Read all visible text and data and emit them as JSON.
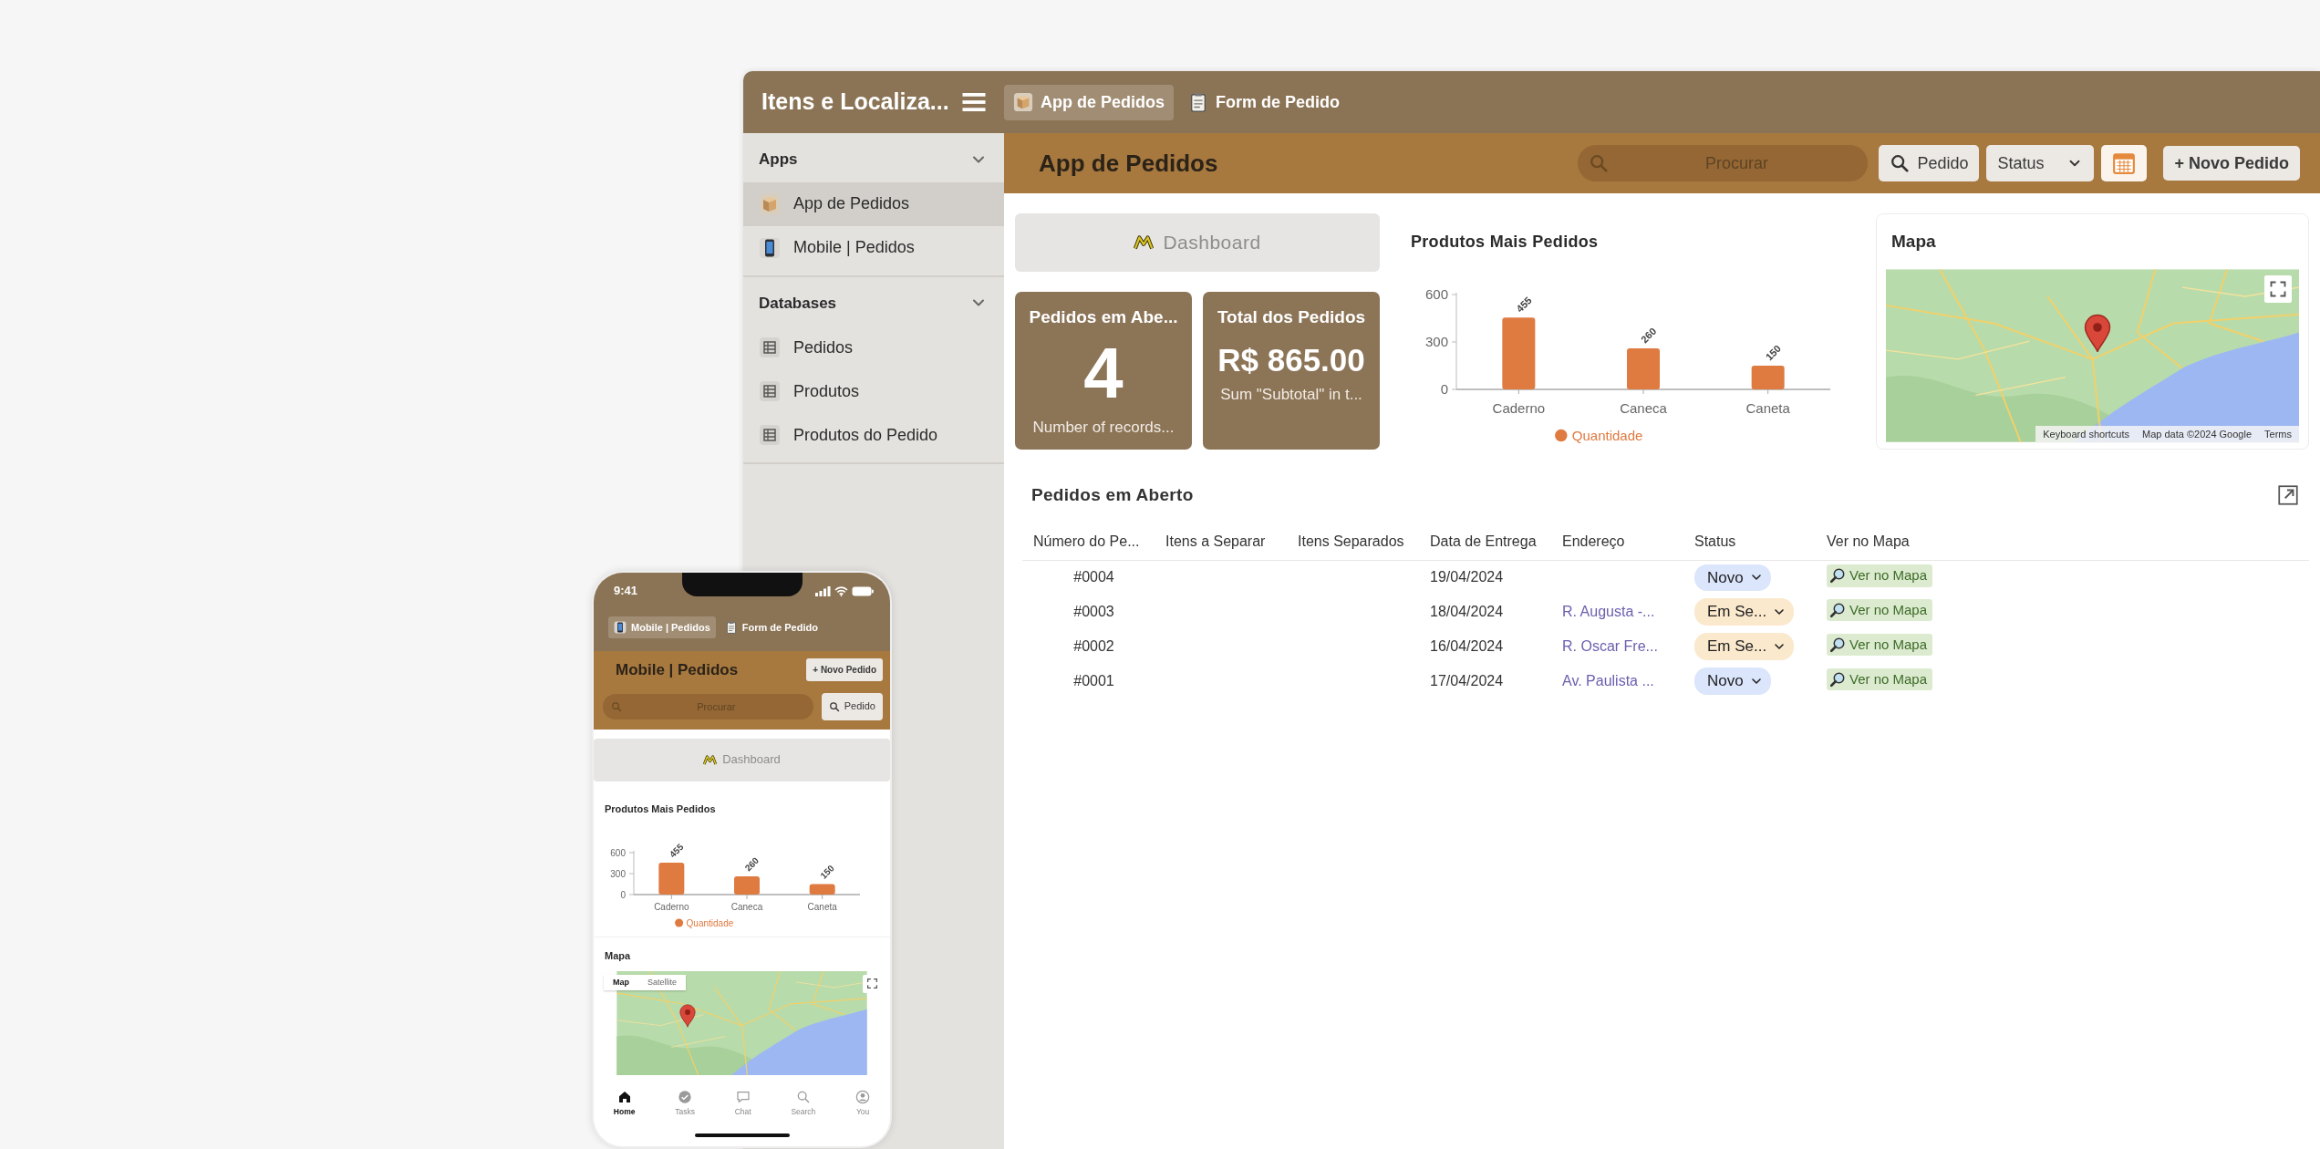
{
  "desktop": {
    "app_title": "Itens e Localiza...",
    "tabs": [
      {
        "label": "App de Pedidos",
        "kind": "app",
        "selected": true
      },
      {
        "label": "Form de Pedido",
        "kind": "form",
        "selected": false
      }
    ],
    "sidebar": [
      {
        "title": "Apps",
        "expanded": true,
        "items": [
          {
            "label": "App de Pedidos",
            "kind": "desktop",
            "selected": true
          },
          {
            "label": "Mobile | Pedidos",
            "kind": "mobile",
            "selected": false
          }
        ]
      },
      {
        "title": "Databases",
        "expanded": true,
        "items": [
          {
            "label": "Pedidos",
            "kind": "table",
            "selected": false
          },
          {
            "label": "Produtos",
            "kind": "table",
            "selected": false
          },
          {
            "label": "Produtos do Pedido",
            "kind": "table",
            "selected": false
          }
        ]
      }
    ],
    "page_title": "App de Pedidos",
    "search": {
      "placeholder": "Procurar"
    },
    "pedido_button": "Pedido",
    "status_filter": "Status",
    "new_button": "+ Novo Pedido",
    "dashboard_label": "Dashboard",
    "stats": [
      {
        "kind": "count",
        "title": "Pedidos em Abe...",
        "value": "4",
        "caption": "Number of records..."
      },
      {
        "kind": "sum",
        "title": "Total dos Pedidos",
        "value": "R$ 865.00",
        "caption": "Sum \"Subtotal\" in t..."
      }
    ],
    "chart": {
      "title": "Produtos Mais Pedidos",
      "chart_data": {
        "type": "bar",
        "categories": [
          "Caderno",
          "Caneca",
          "Caneta"
        ],
        "series": [
          {
            "name": "Quantidade",
            "color": "#df7a40",
            "values": [
              455,
              260,
              150
            ]
          }
        ],
        "ylim": [
          0,
          600
        ],
        "yticks": [
          0,
          300,
          600
        ],
        "data_labels": true
      }
    },
    "map": {
      "title": "Mapa",
      "attribution": [
        "Keyboard shortcuts",
        "Map data ©2024 Google",
        "Terms"
      ]
    },
    "table": {
      "title": "Pedidos em Aberto",
      "columns": [
        "Número do Pe...",
        "Itens a Separar",
        "Itens Separados",
        "Data de Entrega",
        "Endereço",
        "Status",
        "Ver no Mapa"
      ],
      "rows": [
        {
          "number": "#0004",
          "delivery_date": "19/04/2024",
          "status": {
            "label": "Novo",
            "color": "#dbe5fb"
          },
          "map_link": "Ver no Mapa"
        },
        {
          "number": "#0003",
          "delivery_date": "18/04/2024",
          "address": "R. Augusta -...",
          "status": {
            "label": "Em Se...",
            "color": "#fbe9cd"
          },
          "map_link": "Ver no Mapa"
        },
        {
          "number": "#0002",
          "delivery_date": "16/04/2024",
          "address": "R. Oscar Fre...",
          "status": {
            "label": "Em Se...",
            "color": "#fbe9cd"
          },
          "map_link": "Ver no Mapa"
        },
        {
          "number": "#0001",
          "delivery_date": "17/04/2024",
          "address": "Av. Paulista ...",
          "status": {
            "label": "Novo",
            "color": "#dbe5fb"
          },
          "map_link": "Ver no Mapa"
        }
      ]
    }
  },
  "phone": {
    "time": "9:41",
    "tabs": [
      {
        "label": "Mobile | Pedidos",
        "kind": "mobile",
        "selected": true
      },
      {
        "label": "Form de Pedido",
        "kind": "form",
        "selected": false
      }
    ],
    "title": "Mobile | Pedidos",
    "new_button": "+ Novo Pedido",
    "search": {
      "placeholder": "Procurar"
    },
    "pedido_button": "Pedido",
    "dashboard_label": "Dashboard",
    "chart": {
      "title": "Produtos Mais Pedidos",
      "chart_data": {
        "type": "bar",
        "categories": [
          "Caderno",
          "Caneca",
          "Caneta"
        ],
        "series": [
          {
            "name": "Quantidade",
            "color": "#df7a40",
            "values": [
              455,
              260,
              150
            ]
          }
        ],
        "ylim": [
          0,
          600
        ],
        "yticks": [
          0,
          300,
          600
        ],
        "data_labels": true
      }
    },
    "map": {
      "title": "Mapa",
      "modes": [
        {
          "label": "Map",
          "selected": true
        },
        {
          "label": "Satellite",
          "selected": false
        }
      ]
    },
    "nav": [
      {
        "label": "Home",
        "selected": true
      },
      {
        "label": "Tasks",
        "selected": false
      },
      {
        "label": "Chat",
        "selected": false
      },
      {
        "label": "Search",
        "selected": false
      },
      {
        "label": "You",
        "selected": false
      }
    ]
  }
}
